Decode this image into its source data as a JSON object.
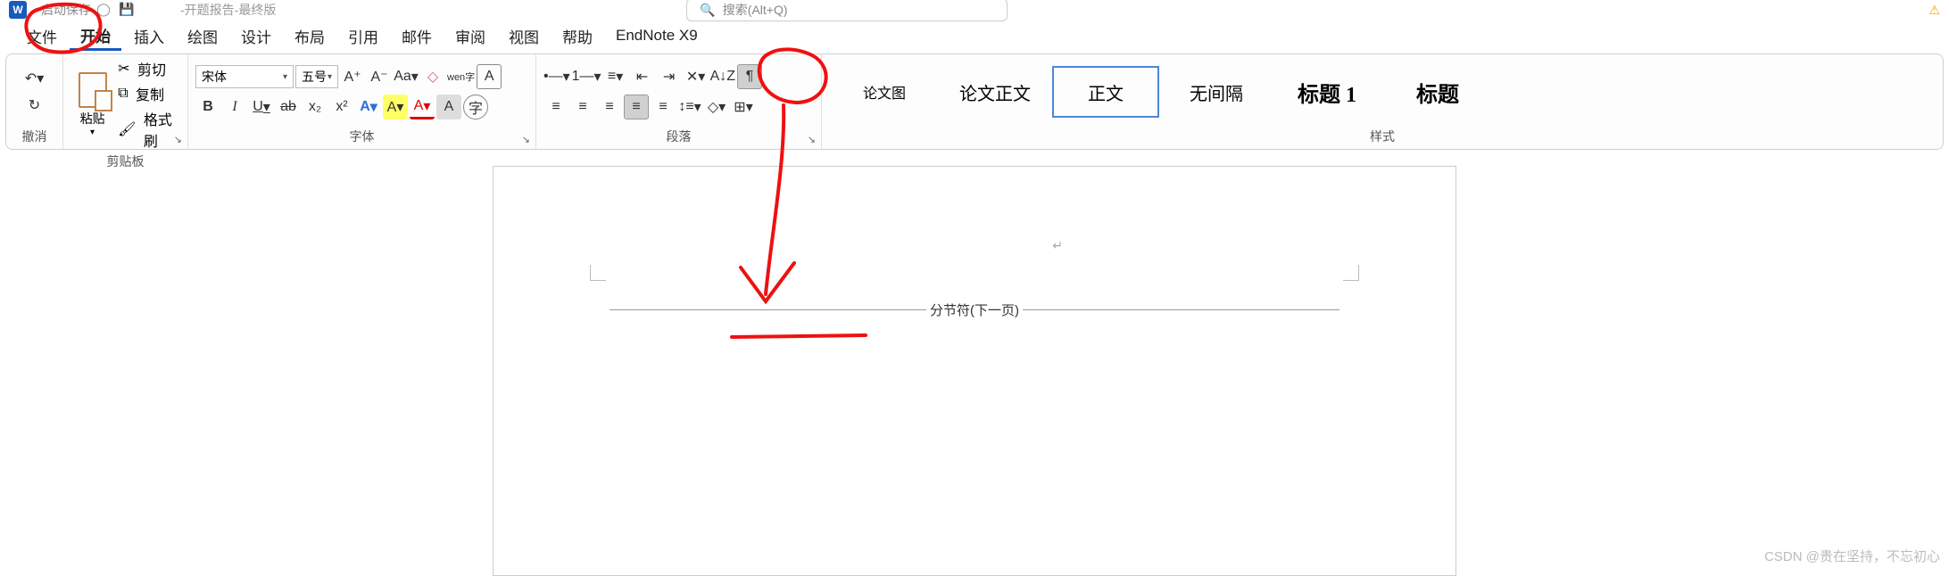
{
  "app": {
    "letter": "W",
    "qa_label": "启动保存",
    "doc_title": "-开题报告-最终版"
  },
  "search": {
    "icon": "🔍",
    "placeholder": "搜索(Alt+Q)"
  },
  "tabs": [
    "文件",
    "开始",
    "插入",
    "绘图",
    "设计",
    "布局",
    "引用",
    "邮件",
    "审阅",
    "视图",
    "帮助",
    "EndNote X9"
  ],
  "active_tab": 1,
  "undo": {
    "group_label": "撤消"
  },
  "clipboard": {
    "paste": "粘贴",
    "cut": "剪切",
    "copy": "复制",
    "format_painter": "格式刷",
    "group_label": "剪贴板"
  },
  "font": {
    "name": "宋体",
    "size": "五号",
    "bold": "B",
    "italic": "I",
    "underline": "U",
    "strike": "ab",
    "sub": "x₂",
    "sup": "x²",
    "text_effect": "A",
    "highlight": "⎯",
    "font_color": "A",
    "char_shade": "A",
    "char_border": "字",
    "grow": "A⁺",
    "shrink": "A⁻",
    "change_case": "Aa",
    "clear": "◇",
    "phonetic": "wen字",
    "enclose": "A",
    "group_label": "字体"
  },
  "paragraph": {
    "bullets": "•—",
    "numbering": "1—",
    "multilevel": "≡",
    "dec_indent": "⇤",
    "inc_indent": "⇥",
    "cn_layout": "✕",
    "sort": "A↓Z",
    "show_marks": "¶",
    "align_l": "≡",
    "align_c": "≡",
    "align_r": "≡",
    "align_j": "≡",
    "align_d": "≡",
    "line_space": "↕≡",
    "shading": "◇",
    "borders": "⊞",
    "group_label": "段落"
  },
  "styles": {
    "items": [
      "论文图",
      "论文正文",
      "正文",
      "无间隔",
      "标题 1",
      "标题"
    ],
    "selected": 2,
    "group_label": "样式"
  },
  "document": {
    "section_break": "分节符(下一页)",
    "para_mark": "↵"
  },
  "watermark": "CSDN @贵在坚持，不忘初心"
}
